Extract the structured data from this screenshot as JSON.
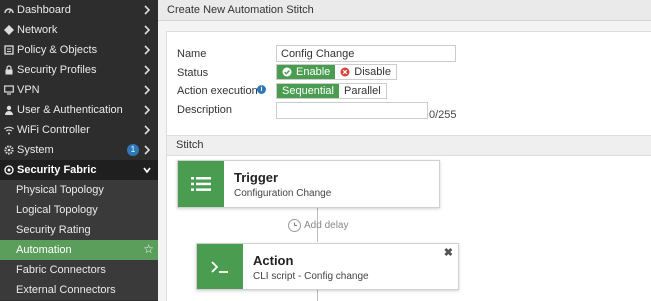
{
  "sidebar": {
    "items": [
      {
        "label": "Dashboard",
        "icon": "dashboard-icon"
      },
      {
        "label": "Network",
        "icon": "network-icon"
      },
      {
        "label": "Policy & Objects",
        "icon": "policy-icon"
      },
      {
        "label": "Security Profiles",
        "icon": "lock-icon"
      },
      {
        "label": "VPN",
        "icon": "monitor-icon"
      },
      {
        "label": "User & Authentication",
        "icon": "user-icon"
      },
      {
        "label": "WiFi Controller",
        "icon": "wifi-icon"
      },
      {
        "label": "System",
        "icon": "gear-icon",
        "badge": "1"
      },
      {
        "label": "Security Fabric",
        "icon": "fabric-icon"
      }
    ],
    "sub_items": [
      {
        "label": "Physical Topology"
      },
      {
        "label": "Logical Topology"
      },
      {
        "label": "Security Rating"
      },
      {
        "label": "Automation"
      },
      {
        "label": "Fabric Connectors"
      },
      {
        "label": "External Connectors"
      }
    ]
  },
  "header": {
    "title": "Create New Automation Stitch"
  },
  "form": {
    "name_label": "Name",
    "name_value": "Config Change",
    "status_label": "Status",
    "status_enable": "Enable",
    "status_disable": "Disable",
    "action_label": "Action execution",
    "action_sequential": "Sequential",
    "action_parallel": "Parallel",
    "description_label": "Description",
    "description_value": "",
    "description_counter": "0/255"
  },
  "stitch": {
    "section_label": "Stitch",
    "trigger_title": "Trigger",
    "trigger_sub": "Configuration Change",
    "add_delay": "Add delay",
    "action_title": "Action",
    "action_sub": "CLI script - Config change"
  },
  "colors": {
    "accent_green": "#4a9c50",
    "sidebar_bg": "#2d2d2d",
    "active_bg": "#5b9e5b",
    "badge_blue": "#2f78b7"
  }
}
